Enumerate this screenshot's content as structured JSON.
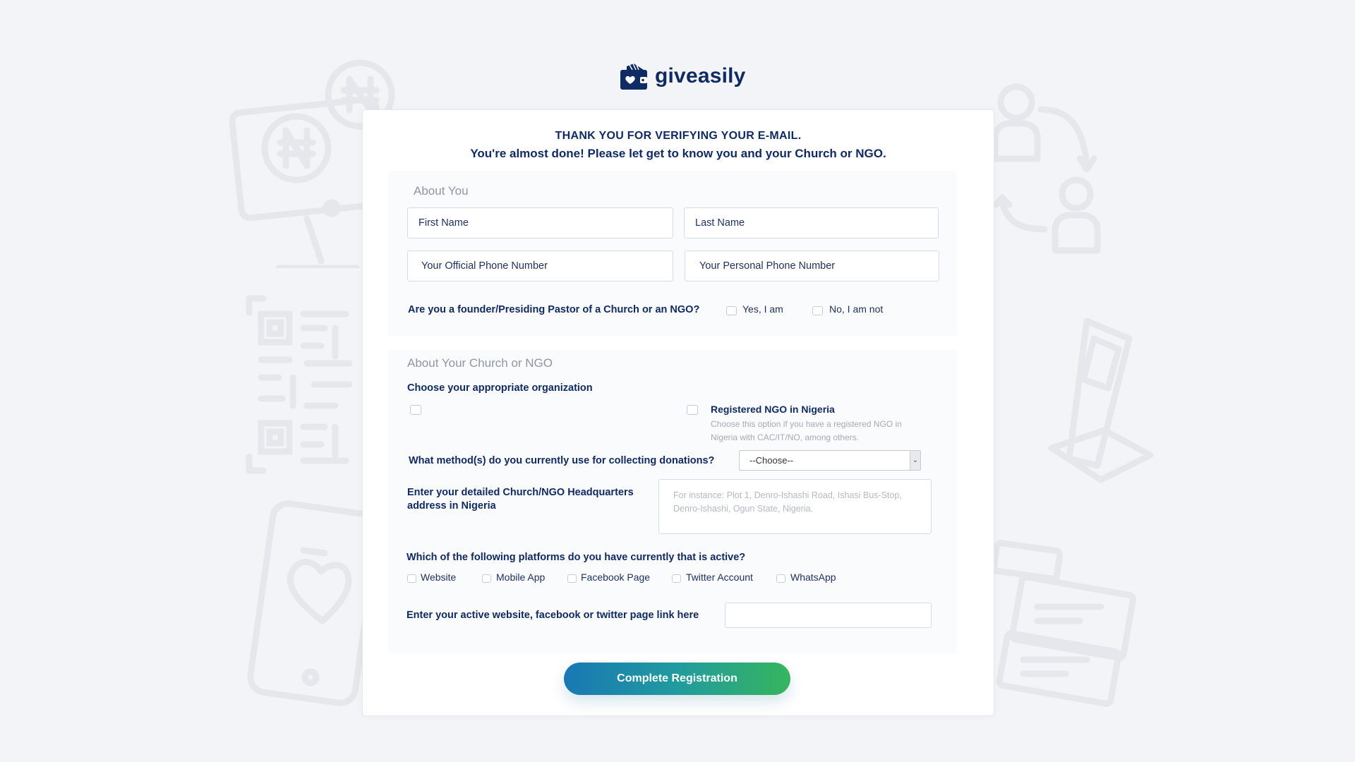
{
  "brand": {
    "name": "giveasily",
    "logo_icon": "wallet-heart-icon"
  },
  "header": {
    "line1": "THANK YOU FOR VERIFYING YOUR E-MAIL.",
    "line2": "You're almost done! Please let get to know you and your Church or NGO."
  },
  "about_you": {
    "title": "About You",
    "first_name_placeholder": "First Name",
    "last_name_placeholder": "Last Name",
    "official_phone_placeholder": "Your Official Phone Number",
    "personal_phone_placeholder": "Your Personal Phone Number",
    "founder_question": "Are you a founder/Presiding Pastor of a Church or an NGO?",
    "yes_label": "Yes, I am",
    "no_label": "No, I am not"
  },
  "about_org": {
    "title": "About Your Church or NGO",
    "choose_label": "Choose your appropriate organization",
    "ngo_option_title": "Registered NGO in Nigeria",
    "ngo_option_hint": "Choose this option if you have a registered NGO in Nigeria with CAC/IT/NO, among others.",
    "donation_method_question": "What method(s) do you currently use for collecting donations?",
    "donation_method_selected": "--Choose--",
    "address_label": "Enter your detailed Church/NGO Headquarters address in Nigeria",
    "address_placeholder": "For instance: Plot 1, Denro-Ishashi Road, Ishasi Bus-Stop, Denro-Ishashi, Ogun State, Nigeria.",
    "platforms_question": "Which of the following platforms do you have currently that is active?",
    "platforms": [
      "Website",
      "Mobile App",
      "Facebook Page",
      "Twitter Account",
      "WhatsApp"
    ],
    "link_label": "Enter your active website, facebook or twitter page link here"
  },
  "cta": {
    "label": "Complete Registration"
  },
  "colors": {
    "brand_navy": "#102a63",
    "gradient_start": "#1978b4",
    "gradient_end": "#36b55f"
  },
  "decor_icons": [
    "monitor-naira-icon",
    "coin-naira-icon",
    "qr-code-icon",
    "phone-heart-icon",
    "users-transfer-icon",
    "kiosk-icon",
    "receipt-icon"
  ]
}
